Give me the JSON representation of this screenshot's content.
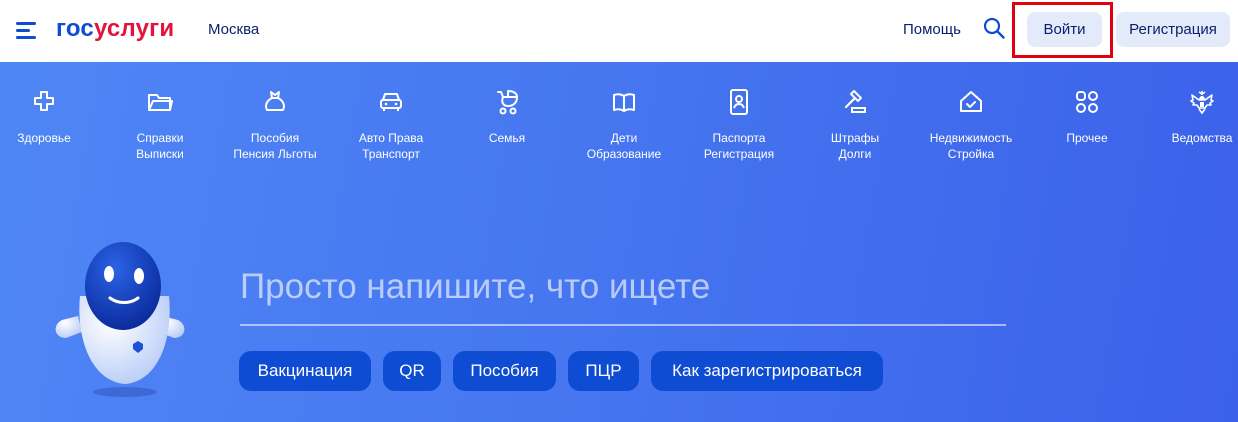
{
  "header": {
    "logo_part1": "гос",
    "logo_part2": "услуги",
    "city": "Москва",
    "help": "Помощь",
    "login": "Войти",
    "register": "Регистрация"
  },
  "categories": [
    {
      "label": "Здоровье",
      "icon": "cross-icon"
    },
    {
      "label": "Справки\nВыписки",
      "icon": "folder-icon"
    },
    {
      "label": "Пособия\nПенсия Льготы",
      "icon": "purse-icon"
    },
    {
      "label": "Авто Права\nТранспорт",
      "icon": "car-icon"
    },
    {
      "label": "Семья",
      "icon": "stroller-icon"
    },
    {
      "label": "Дети\nОбразование",
      "icon": "book-icon"
    },
    {
      "label": "Паспорта\nРегистрация",
      "icon": "passport-icon"
    },
    {
      "label": "Штрафы\nДолги",
      "icon": "gavel-icon"
    },
    {
      "label": "Недвижимость\nСтройка",
      "icon": "house-icon"
    },
    {
      "label": "Прочее",
      "icon": "grid-icon"
    },
    {
      "label": "Ведомства",
      "icon": "emblem-icon"
    }
  ],
  "search": {
    "placeholder": "Просто напишите, что ищете"
  },
  "chips": [
    "Вакцинация",
    "QR",
    "Пособия",
    "ПЦР",
    "Как зарегистрироваться"
  ],
  "colors": {
    "brand_blue": "#0d4cd3",
    "brand_red": "#e3133b",
    "hero_bg": "#4677f0",
    "highlight": "#e0000f"
  }
}
